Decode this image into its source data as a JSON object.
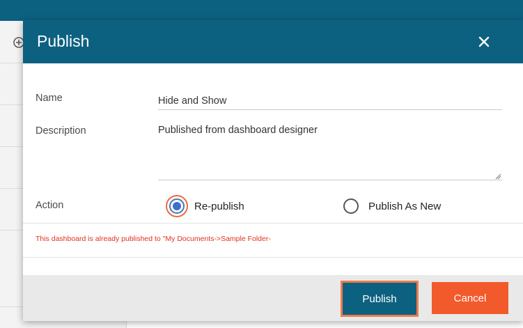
{
  "dialog": {
    "title": "Publish",
    "close_icon": "close-icon"
  },
  "form": {
    "name_label": "Name",
    "name_value": "Hide and Show",
    "description_label": "Description",
    "description_value": "Published from dashboard designer",
    "action_label": "Action",
    "actions": [
      {
        "label": "Re-publish",
        "selected": true
      },
      {
        "label": "Publish As New",
        "selected": false
      }
    ],
    "warning": "This dashboard is already published to \"My Documents->Sample Folder-"
  },
  "footer": {
    "publish_label": "Publish",
    "cancel_label": "Cancel"
  },
  "colors": {
    "header": "#0c6180",
    "publish_button": "#0c6180",
    "cancel_button": "#f35a2b",
    "focus_outline": "#f06a3a",
    "warning_text": "#e0311f",
    "radio_selected": "#3f6fc7"
  }
}
